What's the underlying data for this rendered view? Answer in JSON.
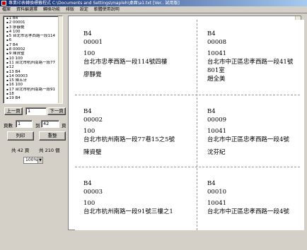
{
  "window": {
    "title": "專業印表轉換標籤程式 C:\\Documents and Settings\\mapleh\\桌面\\a1.txt [Ver.. 試用版]"
  },
  "menu": [
    "檔案",
    "資料編選擇",
    "轉換功能",
    "排版",
    "設定",
    "軟體使用說明"
  ],
  "list": {
    "rows": [
      "1 B4",
      "2 00001",
      "3 廖靜覺",
      "4 100",
      "5 台北市忠孝西路一段114",
      "6",
      "7 B4",
      "8 00002",
      "9 陳資璧",
      "10 100",
      "11 台北市杭州南路一段77",
      "12",
      "13 B4",
      "14 00003",
      "15 陳五牙",
      "16 100",
      "17 台北市杭州南路一段91",
      "18",
      "19 B4"
    ]
  },
  "nav": {
    "prev_label": "上一頁",
    "page_value": "1",
    "next_label": "下一頁",
    "pages_label": "頁數",
    "pages_from": "1",
    "pages_to_label": "到",
    "pages_to": "42",
    "pages_unit": "頁",
    "print_label": "列印",
    "reset_label": "重整",
    "total_pages": "共 42 頁",
    "total_items": "共 210 個",
    "zoom": "100%"
  },
  "labels": [
    {
      "code": "B4",
      "id": "00001",
      "zip": "100",
      "addr": "台北市忠孝西路一段114號四樓",
      "addr2": "",
      "name": "廖靜覺"
    },
    {
      "code": "B4",
      "id": "00008",
      "zip": "10041",
      "addr": "台北市中正區忠孝西路一段41號",
      "addr2": "801室",
      "name": "趙全美"
    },
    {
      "code": "B4",
      "id": "00002",
      "zip": "100",
      "addr": "台北市杭州南路一段77巷15之5號",
      "addr2": "",
      "name": "陳資璧"
    },
    {
      "code": "B4",
      "id": "00009",
      "zip": "10041",
      "addr": "台北市中正區忠孝西路一段4號",
      "addr2": "",
      "name": "沈芬紀"
    },
    {
      "code": "B4",
      "id": "00003",
      "zip": "100",
      "addr": "台北市杭州南路一段91號三樓之1",
      "addr2": "",
      "name": ""
    },
    {
      "code": "B4",
      "id": "00010",
      "zip": "10041",
      "addr": "台北市中正區忠孝西路一段4號",
      "addr2": "",
      "name": ""
    }
  ],
  "icons": {
    "app": "app-icon",
    "dropdown": "chevron-down-icon"
  }
}
